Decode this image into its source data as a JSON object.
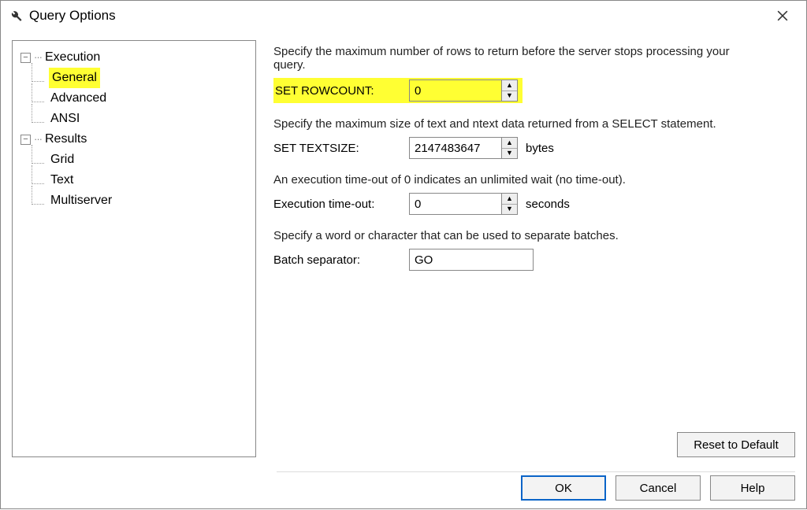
{
  "window": {
    "title": "Query Options"
  },
  "tree": {
    "execution": {
      "label": "Execution",
      "children": {
        "general": "General",
        "advanced": "Advanced",
        "ansi": "ANSI"
      }
    },
    "results": {
      "label": "Results",
      "children": {
        "grid": "Grid",
        "text": "Text",
        "multiserver": "Multiserver"
      }
    }
  },
  "pane": {
    "rowcount_desc": "Specify the maximum number of rows to return before the server stops processing your query.",
    "rowcount_label": "SET ROWCOUNT:",
    "rowcount_value": "0",
    "textsize_desc": "Specify the maximum size of text and ntext data returned from a SELECT statement.",
    "textsize_label": "SET TEXTSIZE:",
    "textsize_value": "2147483647",
    "textsize_unit": "bytes",
    "timeout_desc": "An execution time-out of 0 indicates an unlimited wait (no time-out).",
    "timeout_label": "Execution time-out:",
    "timeout_value": "0",
    "timeout_unit": "seconds",
    "batch_desc": "Specify a word or character that can be used to separate batches.",
    "batch_label": "Batch separator:",
    "batch_value": "GO"
  },
  "buttons": {
    "reset": "Reset to Default",
    "ok": "OK",
    "cancel": "Cancel",
    "help": "Help"
  }
}
